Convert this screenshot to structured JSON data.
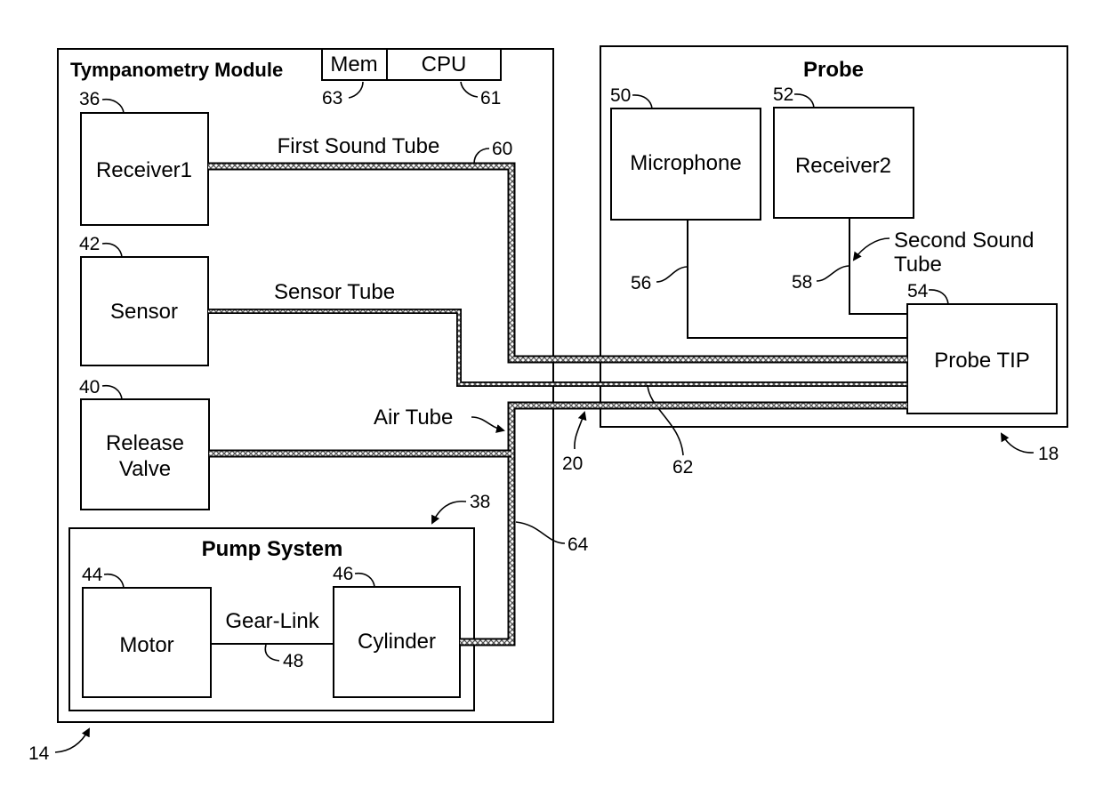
{
  "diagram": {
    "module": {
      "title": "Tympanometry Module",
      "ref": "14",
      "mem_label": "Mem",
      "mem_ref": "63",
      "cpu_label": "CPU",
      "cpu_ref": "61",
      "receiver1": {
        "label": "Receiver1",
        "ref": "36"
      },
      "sensor": {
        "label": "Sensor",
        "ref": "42"
      },
      "release_valve": {
        "label_line1": "Release",
        "label_line2": "Valve",
        "ref": "40"
      },
      "pump_system": {
        "title": "Pump System",
        "ref": "38",
        "motor": {
          "label": "Motor",
          "ref": "44"
        },
        "cylinder": {
          "label": "Cylinder",
          "ref": "46"
        },
        "gear_link": {
          "label": "Gear-Link",
          "ref": "48"
        }
      }
    },
    "probe": {
      "title": "Probe",
      "ref": "18",
      "microphone": {
        "label": "Microphone",
        "ref": "50"
      },
      "receiver2": {
        "label": "Receiver2",
        "ref": "52"
      },
      "probe_tip": {
        "label": "Probe TIP",
        "ref": "54"
      },
      "mic_line_ref": "56",
      "second_sound_tube": {
        "label_line1": "Second Sound",
        "label_line2": "Tube",
        "ref": "58"
      }
    },
    "tubes": {
      "first_sound_tube": {
        "label": "First Sound Tube",
        "ref": "60"
      },
      "sensor_tube": {
        "label": "Sensor Tube",
        "ref": "62"
      },
      "air_tube": {
        "label": "Air Tube",
        "ref": "64"
      },
      "bundle_ref": "20"
    }
  }
}
